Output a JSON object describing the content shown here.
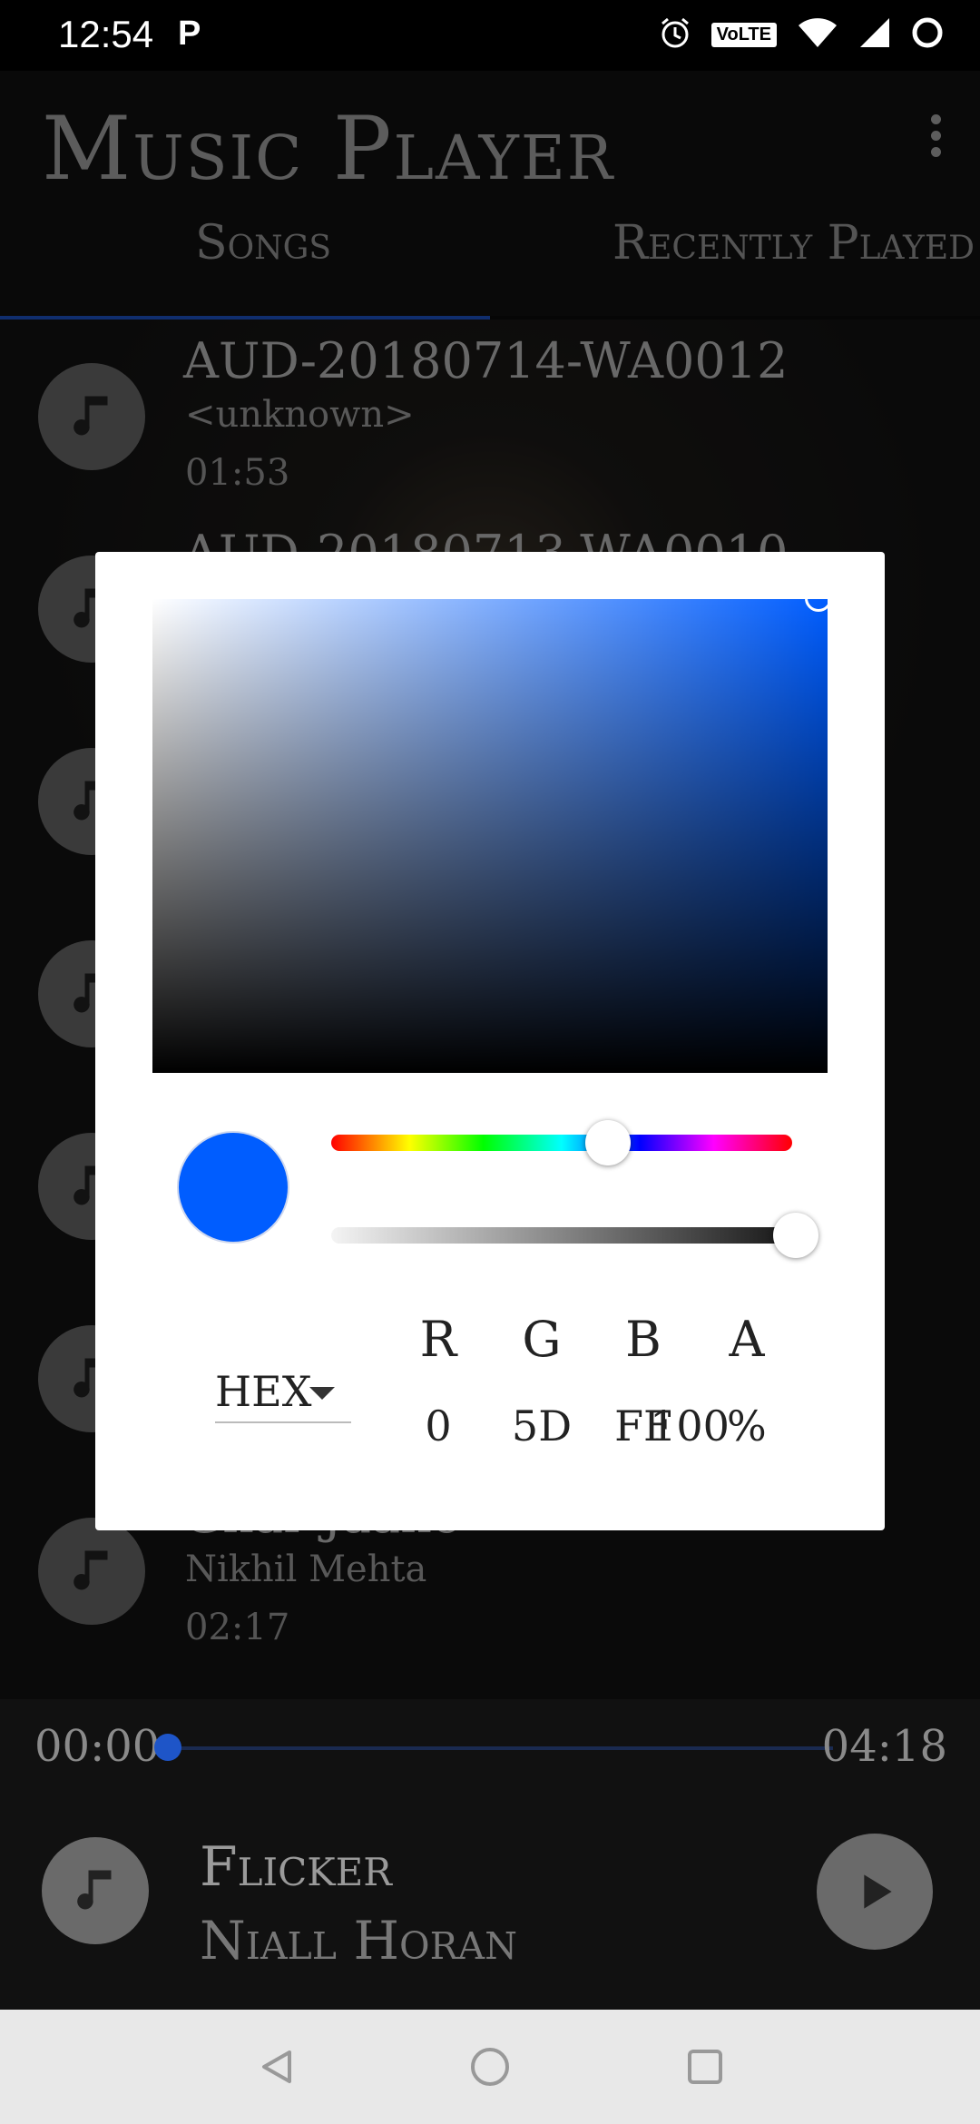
{
  "status_bar": {
    "time": "12:54",
    "notification_icon": "P",
    "volte": "VoLTE",
    "icons": [
      "alarm-icon",
      "volte-icon",
      "wifi-icon",
      "signal-icon",
      "battery-icon"
    ]
  },
  "app_bar": {
    "title": "Music Player",
    "tabs": [
      {
        "label": "Songs",
        "selected": true
      },
      {
        "label": "Recently Played",
        "selected": false
      }
    ],
    "accent_color": "#1e55c8"
  },
  "songs": [
    {
      "title": "AUD-20180714-WA0012",
      "artist": "<unknown>",
      "duration": "01:53"
    },
    {
      "title": "AUD-20180713-WA0010",
      "artist": "",
      "duration": ""
    },
    {
      "title": "",
      "artist": "",
      "duration": ""
    },
    {
      "title": "",
      "artist": "",
      "duration": ""
    },
    {
      "title": "",
      "artist": "",
      "duration": ""
    },
    {
      "title": "",
      "artist": "",
      "duration": ""
    },
    {
      "title": "Ghar Jaane",
      "artist": "Nikhil Mehta",
      "duration": "02:17"
    }
  ],
  "player": {
    "position": "00:00",
    "length": "04:18",
    "progress": 0.0,
    "title": "Flicker",
    "artist": "Niall Horan"
  },
  "color_picker": {
    "current_color": "#005dff",
    "format": "HEX",
    "channels": [
      {
        "label": "R",
        "value": "0"
      },
      {
        "label": "G",
        "value": "5D"
      },
      {
        "label": "B",
        "value": "FF"
      },
      {
        "label": "A",
        "value": "100"
      }
    ],
    "alpha_unit": "%",
    "hue_fraction": 0.6,
    "alpha_fraction": 1.0
  }
}
